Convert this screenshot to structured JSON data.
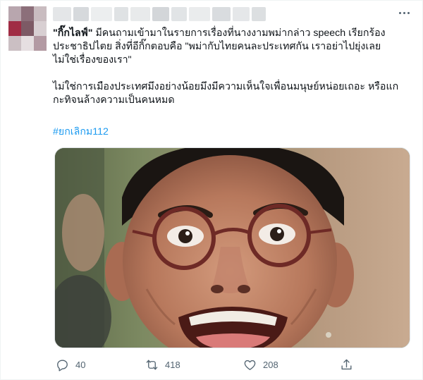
{
  "author": {
    "avatar_colors": [
      "#b8a6ae",
      "#8c6f7a",
      "#c9bcc0",
      "#a02c44",
      "#7d5a65",
      "#d8cfd2",
      "#cbbfc3",
      "#e6dfe1",
      "#b39aa3"
    ],
    "header_colors": [
      "#e4e6e8",
      "#d6d9dc",
      "#eceeef",
      "#dfe2e4",
      "#e8eaeb",
      "#d3d6d9",
      "#e1e4e6",
      "#eaeced",
      "#d9dcdf",
      "#e5e7e9",
      "#dcdfe1"
    ]
  },
  "tweet": {
    "quote_bold": "\"กิ๊กไลฟ์\"",
    "line1_rest": " มีคนถามเข้ามาในรายการเรื่องที่นางงามพม่ากล่าว speech เรียกร้อง",
    "line2": "ประชาธิปไตย สิ่งที่อีกิ๊กตอบคือ \"พม่ากับไทยคนละประเทศกัน เราอย่าไปยุ่งเลย",
    "line3": "ไม่ใช่เรื่องของเรา\"",
    "para2_line1": "ไม่ใช่การเมืองประเทศมึงอย่างน้อยมึงมีความเห็นใจเพื่อนมนุษย์หน่อยเถอะ หรือแก",
    "para2_line2": "กะทิจนล้างความเป็นคนหมด",
    "hashtag": "#ยกเลิกม112"
  },
  "actions": {
    "reply_count": "40",
    "retweet_count": "418",
    "like_count": "208"
  },
  "colors": {
    "hashtag": "#1d9bf0",
    "icon": "#536471"
  }
}
